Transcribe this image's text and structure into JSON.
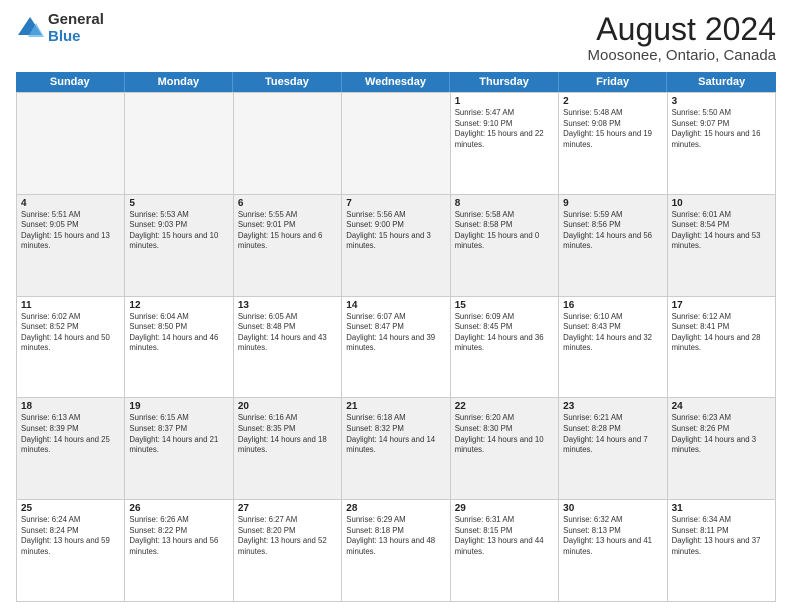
{
  "logo": {
    "general": "General",
    "blue": "Blue"
  },
  "title": "August 2024",
  "subtitle": "Moosonee, Ontario, Canada",
  "days": [
    "Sunday",
    "Monday",
    "Tuesday",
    "Wednesday",
    "Thursday",
    "Friday",
    "Saturday"
  ],
  "weeks": [
    [
      {
        "day": "",
        "info": ""
      },
      {
        "day": "",
        "info": ""
      },
      {
        "day": "",
        "info": ""
      },
      {
        "day": "",
        "info": ""
      },
      {
        "day": "1",
        "info": "Sunrise: 5:47 AM\nSunset: 9:10 PM\nDaylight: 15 hours and 22 minutes."
      },
      {
        "day": "2",
        "info": "Sunrise: 5:48 AM\nSunset: 9:08 PM\nDaylight: 15 hours and 19 minutes."
      },
      {
        "day": "3",
        "info": "Sunrise: 5:50 AM\nSunset: 9:07 PM\nDaylight: 15 hours and 16 minutes."
      }
    ],
    [
      {
        "day": "4",
        "info": "Sunrise: 5:51 AM\nSunset: 9:05 PM\nDaylight: 15 hours and 13 minutes."
      },
      {
        "day": "5",
        "info": "Sunrise: 5:53 AM\nSunset: 9:03 PM\nDaylight: 15 hours and 10 minutes."
      },
      {
        "day": "6",
        "info": "Sunrise: 5:55 AM\nSunset: 9:01 PM\nDaylight: 15 hours and 6 minutes."
      },
      {
        "day": "7",
        "info": "Sunrise: 5:56 AM\nSunset: 9:00 PM\nDaylight: 15 hours and 3 minutes."
      },
      {
        "day": "8",
        "info": "Sunrise: 5:58 AM\nSunset: 8:58 PM\nDaylight: 15 hours and 0 minutes."
      },
      {
        "day": "9",
        "info": "Sunrise: 5:59 AM\nSunset: 8:56 PM\nDaylight: 14 hours and 56 minutes."
      },
      {
        "day": "10",
        "info": "Sunrise: 6:01 AM\nSunset: 8:54 PM\nDaylight: 14 hours and 53 minutes."
      }
    ],
    [
      {
        "day": "11",
        "info": "Sunrise: 6:02 AM\nSunset: 8:52 PM\nDaylight: 14 hours and 50 minutes."
      },
      {
        "day": "12",
        "info": "Sunrise: 6:04 AM\nSunset: 8:50 PM\nDaylight: 14 hours and 46 minutes."
      },
      {
        "day": "13",
        "info": "Sunrise: 6:05 AM\nSunset: 8:48 PM\nDaylight: 14 hours and 43 minutes."
      },
      {
        "day": "14",
        "info": "Sunrise: 6:07 AM\nSunset: 8:47 PM\nDaylight: 14 hours and 39 minutes."
      },
      {
        "day": "15",
        "info": "Sunrise: 6:09 AM\nSunset: 8:45 PM\nDaylight: 14 hours and 36 minutes."
      },
      {
        "day": "16",
        "info": "Sunrise: 6:10 AM\nSunset: 8:43 PM\nDaylight: 14 hours and 32 minutes."
      },
      {
        "day": "17",
        "info": "Sunrise: 6:12 AM\nSunset: 8:41 PM\nDaylight: 14 hours and 28 minutes."
      }
    ],
    [
      {
        "day": "18",
        "info": "Sunrise: 6:13 AM\nSunset: 8:39 PM\nDaylight: 14 hours and 25 minutes."
      },
      {
        "day": "19",
        "info": "Sunrise: 6:15 AM\nSunset: 8:37 PM\nDaylight: 14 hours and 21 minutes."
      },
      {
        "day": "20",
        "info": "Sunrise: 6:16 AM\nSunset: 8:35 PM\nDaylight: 14 hours and 18 minutes."
      },
      {
        "day": "21",
        "info": "Sunrise: 6:18 AM\nSunset: 8:32 PM\nDaylight: 14 hours and 14 minutes."
      },
      {
        "day": "22",
        "info": "Sunrise: 6:20 AM\nSunset: 8:30 PM\nDaylight: 14 hours and 10 minutes."
      },
      {
        "day": "23",
        "info": "Sunrise: 6:21 AM\nSunset: 8:28 PM\nDaylight: 14 hours and 7 minutes."
      },
      {
        "day": "24",
        "info": "Sunrise: 6:23 AM\nSunset: 8:26 PM\nDaylight: 14 hours and 3 minutes."
      }
    ],
    [
      {
        "day": "25",
        "info": "Sunrise: 6:24 AM\nSunset: 8:24 PM\nDaylight: 13 hours and 59 minutes."
      },
      {
        "day": "26",
        "info": "Sunrise: 6:26 AM\nSunset: 8:22 PM\nDaylight: 13 hours and 56 minutes."
      },
      {
        "day": "27",
        "info": "Sunrise: 6:27 AM\nSunset: 8:20 PM\nDaylight: 13 hours and 52 minutes."
      },
      {
        "day": "28",
        "info": "Sunrise: 6:29 AM\nSunset: 8:18 PM\nDaylight: 13 hours and 48 minutes."
      },
      {
        "day": "29",
        "info": "Sunrise: 6:31 AM\nSunset: 8:15 PM\nDaylight: 13 hours and 44 minutes."
      },
      {
        "day": "30",
        "info": "Sunrise: 6:32 AM\nSunset: 8:13 PM\nDaylight: 13 hours and 41 minutes."
      },
      {
        "day": "31",
        "info": "Sunrise: 6:34 AM\nSunset: 8:11 PM\nDaylight: 13 hours and 37 minutes."
      }
    ]
  ]
}
